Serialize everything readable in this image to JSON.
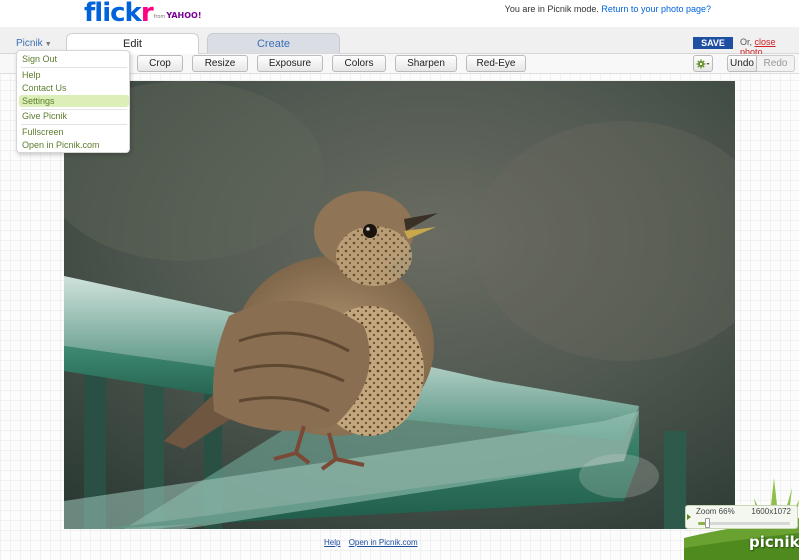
{
  "header": {
    "logo_flickr_a": "flick",
    "logo_flickr_b": "r",
    "logo_from": "from",
    "logo_yahoo": "YAHOO!",
    "mode_text": "You are in Picnik mode.",
    "mode_link": "Return to your photo page?"
  },
  "tabs": {
    "menu_label": "Picnik",
    "edit_label": "Edit",
    "create_label": "Create",
    "save_label": "SAVE",
    "or_text": "Or,",
    "close_label": "close photo"
  },
  "toolbar": {
    "crop": "Crop",
    "resize": "Resize",
    "exposure": "Exposure",
    "colors": "Colors",
    "sharpen": "Sharpen",
    "redeye": "Red-Eye",
    "undo": "Undo",
    "redo": "Redo"
  },
  "menu": {
    "sign_out": "Sign Out",
    "help": "Help",
    "contact_us": "Contact Us",
    "settings": "Settings",
    "give_picnik": "Give Picnik",
    "fullscreen": "Fullscreen",
    "open_picnik": "Open in Picnik.com"
  },
  "footer": {
    "help": "Help",
    "open_picnik": "Open in Picnik.com"
  },
  "zoom": {
    "label": "Zoom 66%",
    "dimensions": "1600x1072",
    "level": 0.66
  },
  "brand": {
    "picnik": "picnik"
  },
  "colors": {
    "flickr_blue": "#0063dc",
    "flickr_pink": "#ff0084",
    "save_blue": "#1e4fa0",
    "menu_green": "#5b7d2e",
    "menu_highlight": "#dcefb8"
  },
  "icons": {
    "gear": "gear-icon",
    "menu_caret": "chevron-down-icon",
    "zoom_play": "triangle-right-icon"
  }
}
